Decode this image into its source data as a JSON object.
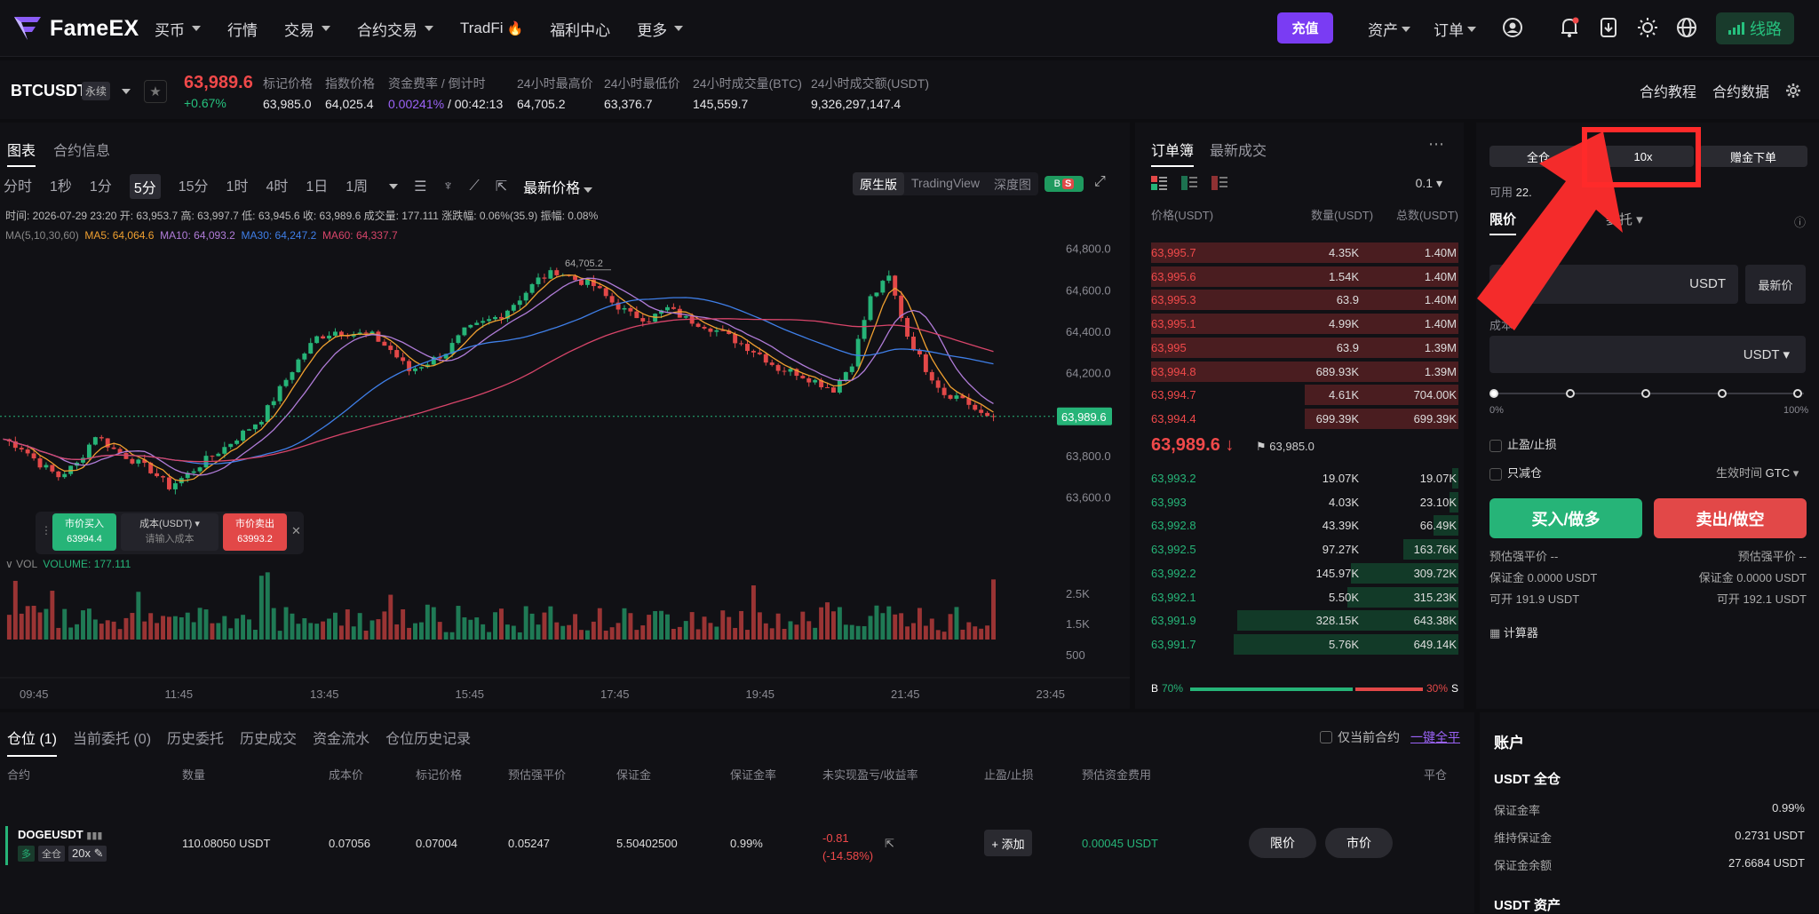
{
  "nav": {
    "logo": "FameEX",
    "menu": [
      {
        "label": "买币",
        "caret": true
      },
      {
        "label": "行情",
        "caret": false
      },
      {
        "label": "交易",
        "caret": true
      },
      {
        "label": "合约交易",
        "caret": true
      },
      {
        "label": "TradFi",
        "caret": false
      },
      {
        "label": "福利中心",
        "caret": false
      },
      {
        "label": "更多",
        "caret": true
      }
    ],
    "deposit": "充值",
    "assets": "资产",
    "orders": "订单",
    "route": "线路"
  },
  "ticker": {
    "symbol": "BTCUSDT",
    "perp": "永续",
    "price": "63,989.6",
    "change": "+0.67%",
    "stats": [
      {
        "label": "标记价格",
        "value": "63,985.0"
      },
      {
        "label": "指数价格",
        "value": "64,025.4"
      },
      {
        "label": "资金费率 / 倒计时",
        "value_a": "0.00241%",
        "value_b": " / 00:42:13"
      },
      {
        "label": "24小时最高价",
        "value": "64,705.2"
      },
      {
        "label": "24小时最低价",
        "value": "63,376.7"
      },
      {
        "label": "24小时成交量(BTC)",
        "value": "145,559.7"
      },
      {
        "label": "24小时成交额(USDT)",
        "value": "9,326,297,147.4"
      }
    ],
    "tutorial": "合约教程",
    "data": "合约数据"
  },
  "chart": {
    "tabs": [
      "图表",
      "合约信息"
    ],
    "timeframes": [
      "分时",
      "1秒",
      "1分",
      "5分",
      "15分",
      "1时",
      "4时",
      "1日",
      "1周"
    ],
    "active_tf": "5分",
    "price_type": "最新价格",
    "views": [
      "原生版",
      "TradingView",
      "深度图"
    ],
    "bs": "B",
    "bs2": "S",
    "ohlc": "时间: 2026-07-29 23:20  开: 63,953.7  高: 63,997.7  低: 63,945.6  收: 63,989.6  成交量: 177.111  涨跌幅: 0.06%(35.9)  振幅: 0.08%",
    "ma_label": "MA(5,10,30,60)",
    "ma5": "MA5: 64,064.6",
    "ma10": "MA10: 64,093.2",
    "ma30": "MA30: 64,247.2",
    "ma60": "MA60: 64,337.7",
    "vol_label": "VOL",
    "vol_value": "VOLUME: 177.111",
    "high_label": "64,705.2",
    "last_price": "63,989.6",
    "popup": {
      "buy": "市价买入",
      "buy_price": "63994.4",
      "cost": "成本(USDT)",
      "cost_ph": "请输入成本",
      "sell": "市价卖出",
      "sell_price": "63993.2"
    },
    "colors": {
      "up": "#26b478",
      "down": "#e24848",
      "ma5": "#f0a030",
      "ma10": "#b07cd8",
      "ma30": "#3f7fe8",
      "ma60": "#d8456a"
    }
  },
  "chart_data": {
    "type": "candlestick",
    "y_ticks": [
      "64,800.0",
      "64,600.0",
      "64,400.0",
      "64,200.0",
      "64,000.0",
      "63,800.0",
      "63,600.0"
    ],
    "x_ticks": [
      "09:45",
      "11:45",
      "13:45",
      "15:45",
      "17:45",
      "19:45",
      "21:45",
      "23:45"
    ],
    "vol_ticks": [
      "2.5K",
      "1.5K",
      "500"
    ],
    "ylim": [
      63500,
      64850
    ],
    "close_path": [
      63880,
      63840,
      63760,
      63700,
      63760,
      63900,
      63830,
      63780,
      63730,
      63650,
      63710,
      63780,
      63840,
      63910,
      63980,
      64120,
      64260,
      64370,
      64400,
      64390,
      64380,
      64310,
      64210,
      64250,
      64300,
      64400,
      64440,
      64480,
      64560,
      64650,
      64690,
      64650,
      64620,
      64540,
      64480,
      64460,
      64510,
      64460,
      64430,
      64390,
      64340,
      64290,
      64220,
      64200,
      64160,
      64120,
      64250,
      64560,
      64660,
      64380,
      64220,
      64100,
      64080,
      63990
    ]
  },
  "book": {
    "tabs": [
      "订单簿",
      "最新成交"
    ],
    "precision": "0.1",
    "headers": [
      "价格(USDT)",
      "数量(USDT)",
      "总数(USDT)"
    ],
    "asks": [
      [
        "63,995.7",
        "4.35K",
        "1.40M",
        1.0
      ],
      [
        "63,995.6",
        "1.54K",
        "1.40M",
        1.0
      ],
      [
        "63,995.3",
        "63.9",
        "1.40M",
        1.0
      ],
      [
        "63,995.1",
        "4.99K",
        "1.40M",
        1.0
      ],
      [
        "63,995",
        "63.9",
        "1.39M",
        1.0
      ],
      [
        "63,994.8",
        "689.93K",
        "1.39M",
        1.0
      ],
      [
        "63,994.7",
        "4.61K",
        "704.00K",
        0.5
      ],
      [
        "63,994.4",
        "699.39K",
        "699.39K",
        0.5
      ]
    ],
    "mid_price": "63,989.6 ↓",
    "mark": "63,985.0",
    "bids": [
      [
        "63,993.2",
        "19.07K",
        "19.07K",
        0.02
      ],
      [
        "63,993",
        "4.03K",
        "23.10K",
        0.03
      ],
      [
        "63,992.8",
        "43.39K",
        "66.49K",
        0.08
      ],
      [
        "63,992.5",
        "97.27K",
        "163.76K",
        0.18
      ],
      [
        "63,992.2",
        "145.97K",
        "309.72K",
        0.35
      ],
      [
        "63,992.1",
        "5.50K",
        "315.23K",
        0.36
      ],
      [
        "63,991.9",
        "328.15K",
        "643.38K",
        0.72
      ],
      [
        "63,991.7",
        "5.76K",
        "649.14K",
        0.73
      ]
    ],
    "buy_ratio": "70%",
    "sell_ratio": "30%",
    "b": "B",
    "s": "S"
  },
  "form": {
    "margin_mode": "全仓",
    "leverage": "10x",
    "bonus": "赠金下单",
    "available": "可用",
    "available_value": "22.",
    "limit": "限价",
    "stop": "委托",
    "price_unit": "USDT",
    "latest": "最新价",
    "price_value": ".6",
    "cost_label": "成本",
    "cost_unit": "USDT",
    "pct_min": "0%",
    "pct_max": "100%",
    "tpsl": "止盈/止损",
    "reduce": "只减仓",
    "tif": "生效时间",
    "tif_value": "GTC",
    "buy": "买入/做多",
    "sell": "卖出/做空",
    "liq_buy": "预估强平价 --",
    "liq_sell": "预估强平价 --",
    "margin_buy": "保证金 0.0000 USDT",
    "margin_sell": "保证金 0.0000 USDT",
    "open_buy": "可开 191.9 USDT",
    "open_sell": "可开 192.1 USDT",
    "calc": "计算器"
  },
  "positions": {
    "tabs": [
      "仓位 (1)",
      "当前委托 (0)",
      "历史委托",
      "历史成交",
      "资金流水",
      "仓位历史记录"
    ],
    "only_current": "仅当前合约",
    "close_all": "一键全平",
    "headers": [
      "合约",
      "数量",
      "成本价",
      "标记价格",
      "预估强平价",
      "保证金",
      "保证金率",
      "未实现盈亏/收益率",
      "止盈/止损",
      "预估资金费用",
      "平仓"
    ],
    "row": {
      "symbol": "DOGEUSDT",
      "side": "多",
      "mode": "全仓",
      "lev": "20x",
      "qty": "110.08050 USDT",
      "entry": "0.07056",
      "mark": "0.07004",
      "liq": "0.05247",
      "margin": "5.50402500",
      "ratio": "0.99%",
      "pnl": "-0.81",
      "pnl_pct": "(-14.58%)",
      "add": "+ 添加",
      "fee": "0.00045 USDT",
      "limit": "限价",
      "market": "市价"
    }
  },
  "account": {
    "title": "账户",
    "section": "USDT 全仓",
    "rows": [
      {
        "label": "保证金率",
        "value": "0.99%"
      },
      {
        "label": "维持保证金",
        "value": "0.2731 USDT"
      },
      {
        "label": "保证金余额",
        "value": "27.6684 USDT"
      }
    ],
    "assets": "USDT 资产"
  }
}
